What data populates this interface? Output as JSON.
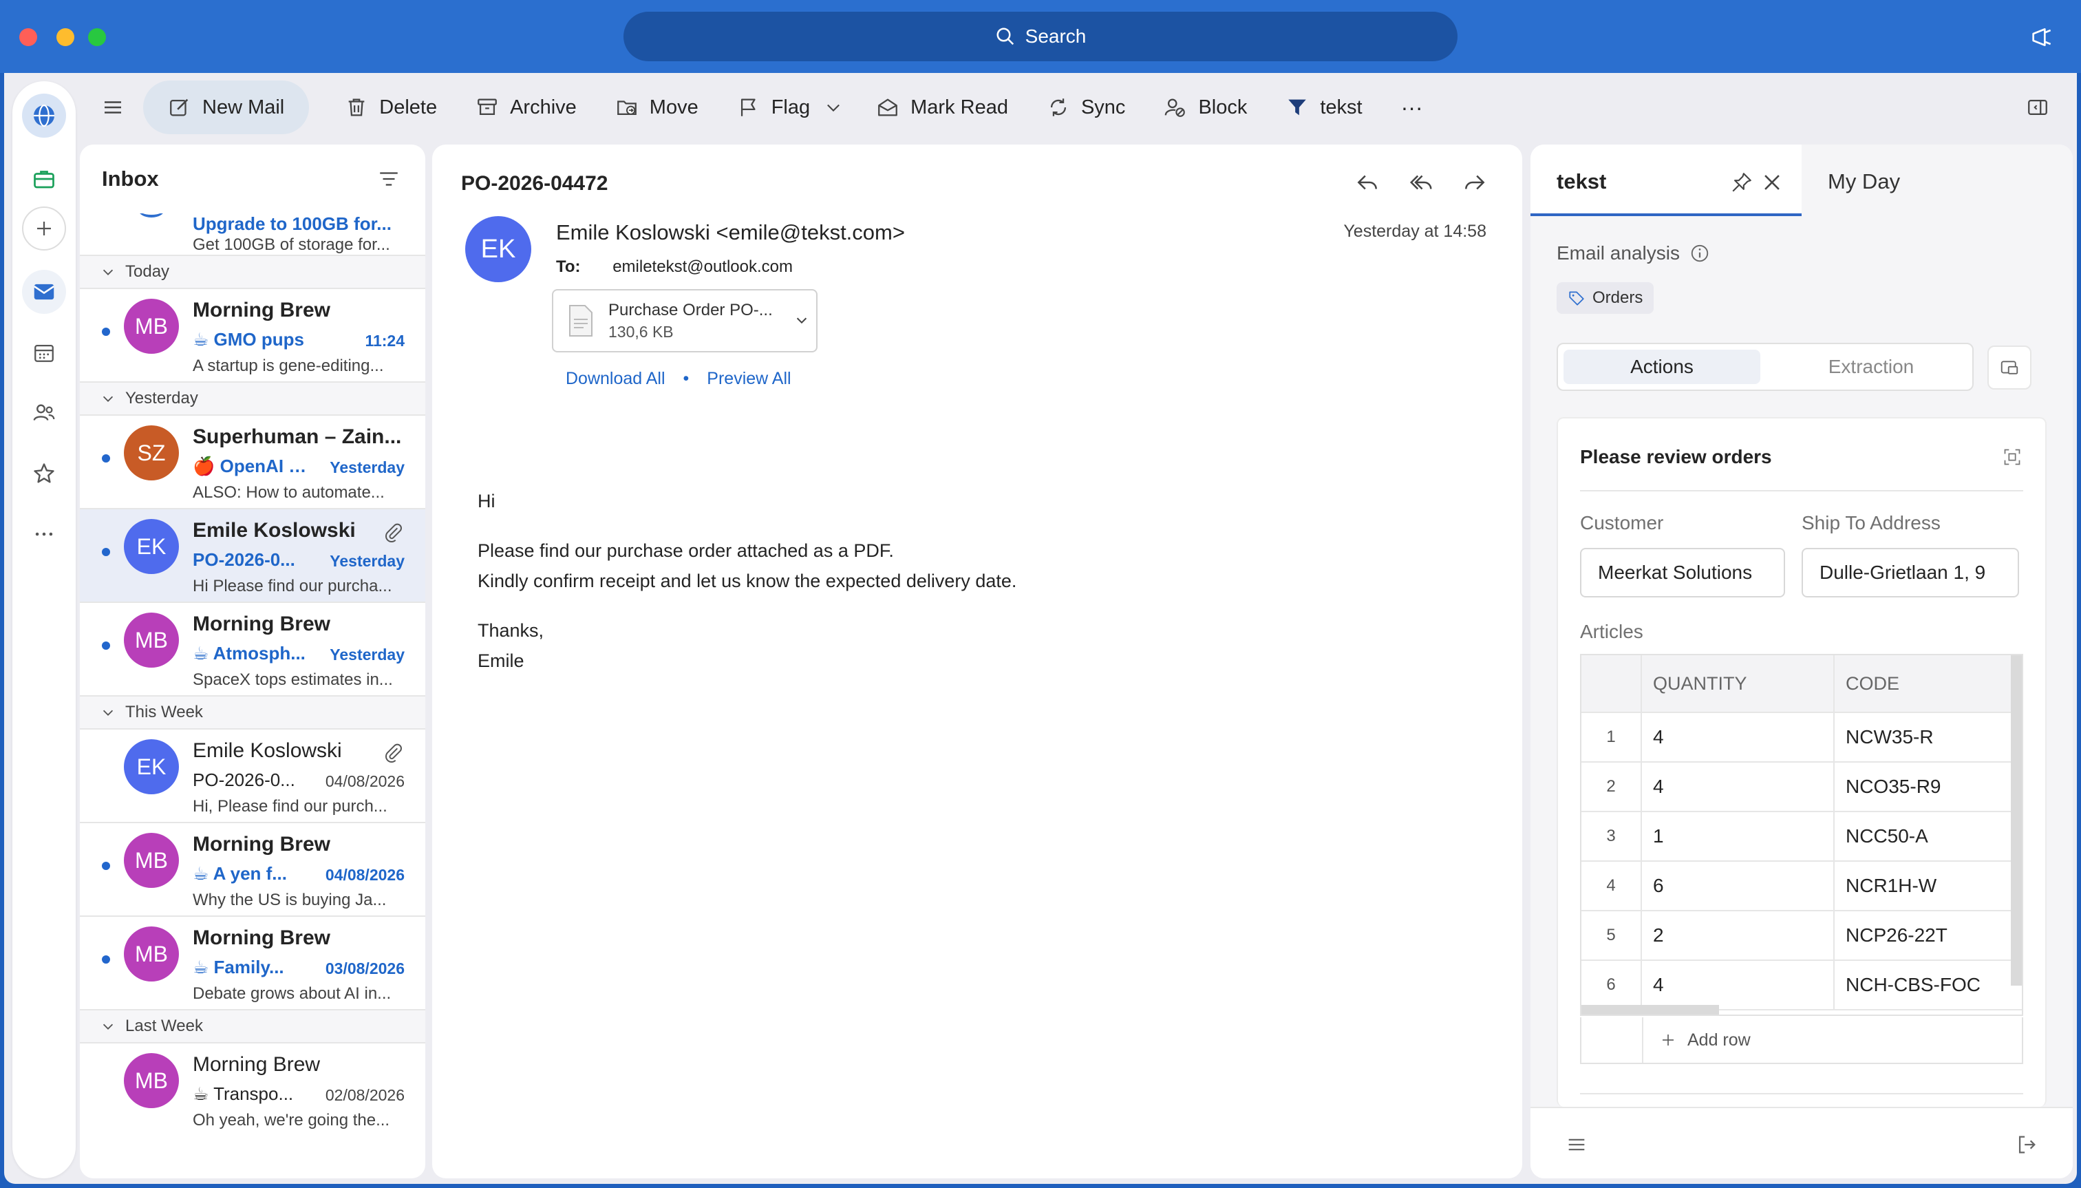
{
  "titlebar": {
    "search_label": "Search"
  },
  "colors": {
    "titlebar": "#2b6fcf",
    "accent": "#1f66c9",
    "unread_dot": "#2266cc",
    "avatar_mb": "#b83fb9",
    "avatar_sz": "#c85b26",
    "avatar_ek": "#4f6bed"
  },
  "toolbar": {
    "new_mail": "New Mail",
    "delete": "Delete",
    "archive": "Archive",
    "move": "Move",
    "flag": "Flag",
    "mark_read": "Mark Read",
    "sync": "Sync",
    "block": "Block",
    "tekst": "tekst",
    "more": "···"
  },
  "inbox": {
    "title": "Inbox",
    "top_item": {
      "subject": "Upgrade to 100GB for...",
      "preview": "Get 100GB of storage for..."
    },
    "groups": {
      "today": "Today",
      "yesterday": "Yesterday",
      "this_week": "This Week",
      "last_week": "Last Week"
    },
    "items": [
      {
        "initials": "MB",
        "sender": "Morning Brew",
        "subject": "☕ GMO pups",
        "time": "11:24",
        "preview": "A startup is gene-editing...",
        "unread": true
      },
      {
        "initials": "SZ",
        "sender": "Superhuman – Zain...",
        "subject": "🍎 OpenAI c...",
        "time": "Yesterday",
        "preview": "ALSO: How to automate...",
        "unread": true
      },
      {
        "initials": "EK",
        "sender": "Emile Koslowski",
        "subject": "PO-2026-0...",
        "time": "Yesterday",
        "preview": "Hi Please find our purcha...",
        "unread": true
      },
      {
        "initials": "MB",
        "sender": "Morning Brew",
        "subject": "☕ Atmosph...",
        "time": "Yesterday",
        "preview": "SpaceX tops estimates in...",
        "unread": true
      },
      {
        "initials": "EK",
        "sender": "Emile Koslowski",
        "subject": "PO-2026-0...",
        "time": "04/08/2026",
        "preview": "Hi, Please find our purch...",
        "unread": false
      },
      {
        "initials": "MB",
        "sender": "Morning Brew",
        "subject": "☕ A yen f...",
        "time": "04/08/2026",
        "preview": "Why the US is buying Ja...",
        "unread": true
      },
      {
        "initials": "MB",
        "sender": "Morning Brew",
        "subject": "☕ Family...",
        "time": "03/08/2026",
        "preview": "Debate grows about AI in...",
        "unread": true
      },
      {
        "initials": "MB",
        "sender": "Morning Brew",
        "subject": "☕ Transpo...",
        "time": "02/08/2026",
        "preview": "Oh yeah, we're going the...",
        "unread": false
      }
    ]
  },
  "message": {
    "subject": "PO-2026-04472",
    "avatar": "EK",
    "from": "Emile Koslowski <emile@tekst.com>",
    "date": "Yesterday at 14:58",
    "to_label": "To:",
    "to": "emiletekst@outlook.com",
    "attachment_name": "Purchase Order PO-...",
    "attachment_size": "130,6 KB",
    "download_all": "Download All",
    "link_sep": "•",
    "preview_all": "Preview All",
    "body": {
      "greeting": "Hi",
      "line1": "Please find our purchase order attached as a PDF.",
      "line2": "Kindly confirm receipt and let us know the expected delivery date.",
      "thanks": "Thanks,",
      "signature": "Emile"
    }
  },
  "addin": {
    "tab_title": "tekst",
    "tab_myday": "My Day",
    "email_analysis": "Email analysis",
    "tag": "Orders",
    "seg_actions": "Actions",
    "seg_extraction": "Extraction",
    "card_title": "Please review orders",
    "customer_label": "Customer",
    "customer_value": "Meerkat Solutions",
    "ship_label": "Ship To Address",
    "ship_value": "Dulle-Grietlaan 1, 9",
    "articles_label": "Articles",
    "col_qty": "QUANTITY",
    "col_code": "CODE",
    "rows": [
      {
        "n": "1",
        "qty": "4",
        "code": "NCW35-R"
      },
      {
        "n": "2",
        "qty": "4",
        "code": "NCO35-R9"
      },
      {
        "n": "3",
        "qty": "1",
        "code": "NCC50-A"
      },
      {
        "n": "4",
        "qty": "6",
        "code": "NCR1H-W"
      },
      {
        "n": "5",
        "qty": "2",
        "code": "NCP26-22T"
      },
      {
        "n": "6",
        "qty": "4",
        "code": "NCH-CBS-FOC"
      }
    ],
    "add_row": "Add row"
  }
}
